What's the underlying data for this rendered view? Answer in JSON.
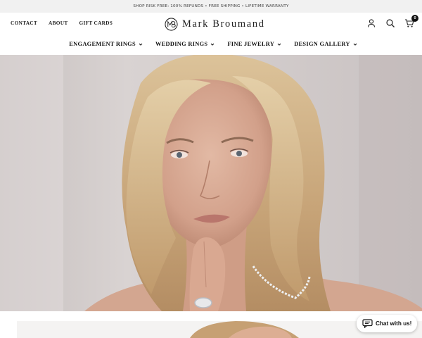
{
  "announcement": {
    "text": "SHOP RISK FREE: 100% REFUNDS • FREE SHIPPING • LIFETIME WARRANTY"
  },
  "utility_nav": [
    {
      "label": "CONTACT"
    },
    {
      "label": "ABOUT"
    },
    {
      "label": "GIFT CARDS"
    }
  ],
  "brand": {
    "name": "Mark Broumand"
  },
  "header_icons": [
    {
      "icon": "account-icon"
    },
    {
      "icon": "search-icon"
    },
    {
      "icon": "cart-icon",
      "badge": "0"
    }
  ],
  "main_nav": [
    {
      "label": "ENGAGEMENT RINGS"
    },
    {
      "label": "WEDDING RINGS"
    },
    {
      "label": "FINE JEWELRY"
    },
    {
      "label": "DESIGN GALLERY"
    }
  ],
  "hero": {
    "image": "portrait of blonde woman wearing diamond ring and necklace"
  },
  "chat": {
    "label": "Chat with us!"
  }
}
